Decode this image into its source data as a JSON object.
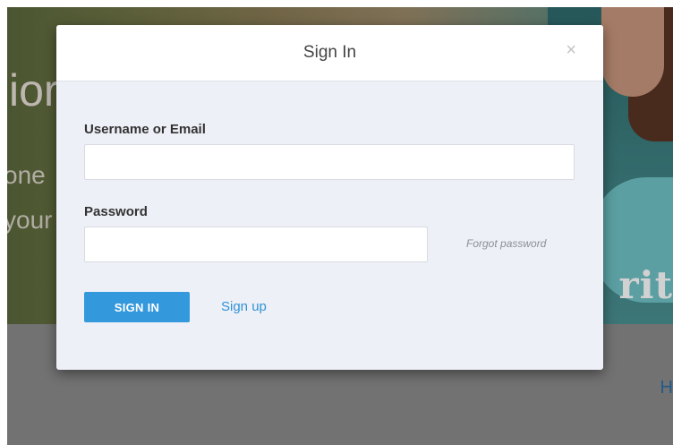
{
  "background": {
    "hero_line_1": "ior",
    "hero_line_2": "one",
    "hero_line_3": "your",
    "sign_text": "rit",
    "band_letter": "H"
  },
  "modal": {
    "title": "Sign In",
    "close_glyph": "×",
    "username_label": "Username or Email",
    "username_value": "",
    "password_label": "Password",
    "password_value": "",
    "forgot_link": "Forgot password",
    "sign_in_button": "SIGN IN",
    "sign_up_link": "Sign up"
  },
  "colors": {
    "primary_button": "#3499dc",
    "link": "#2e93d6",
    "modal_body": "#eef0f7"
  }
}
